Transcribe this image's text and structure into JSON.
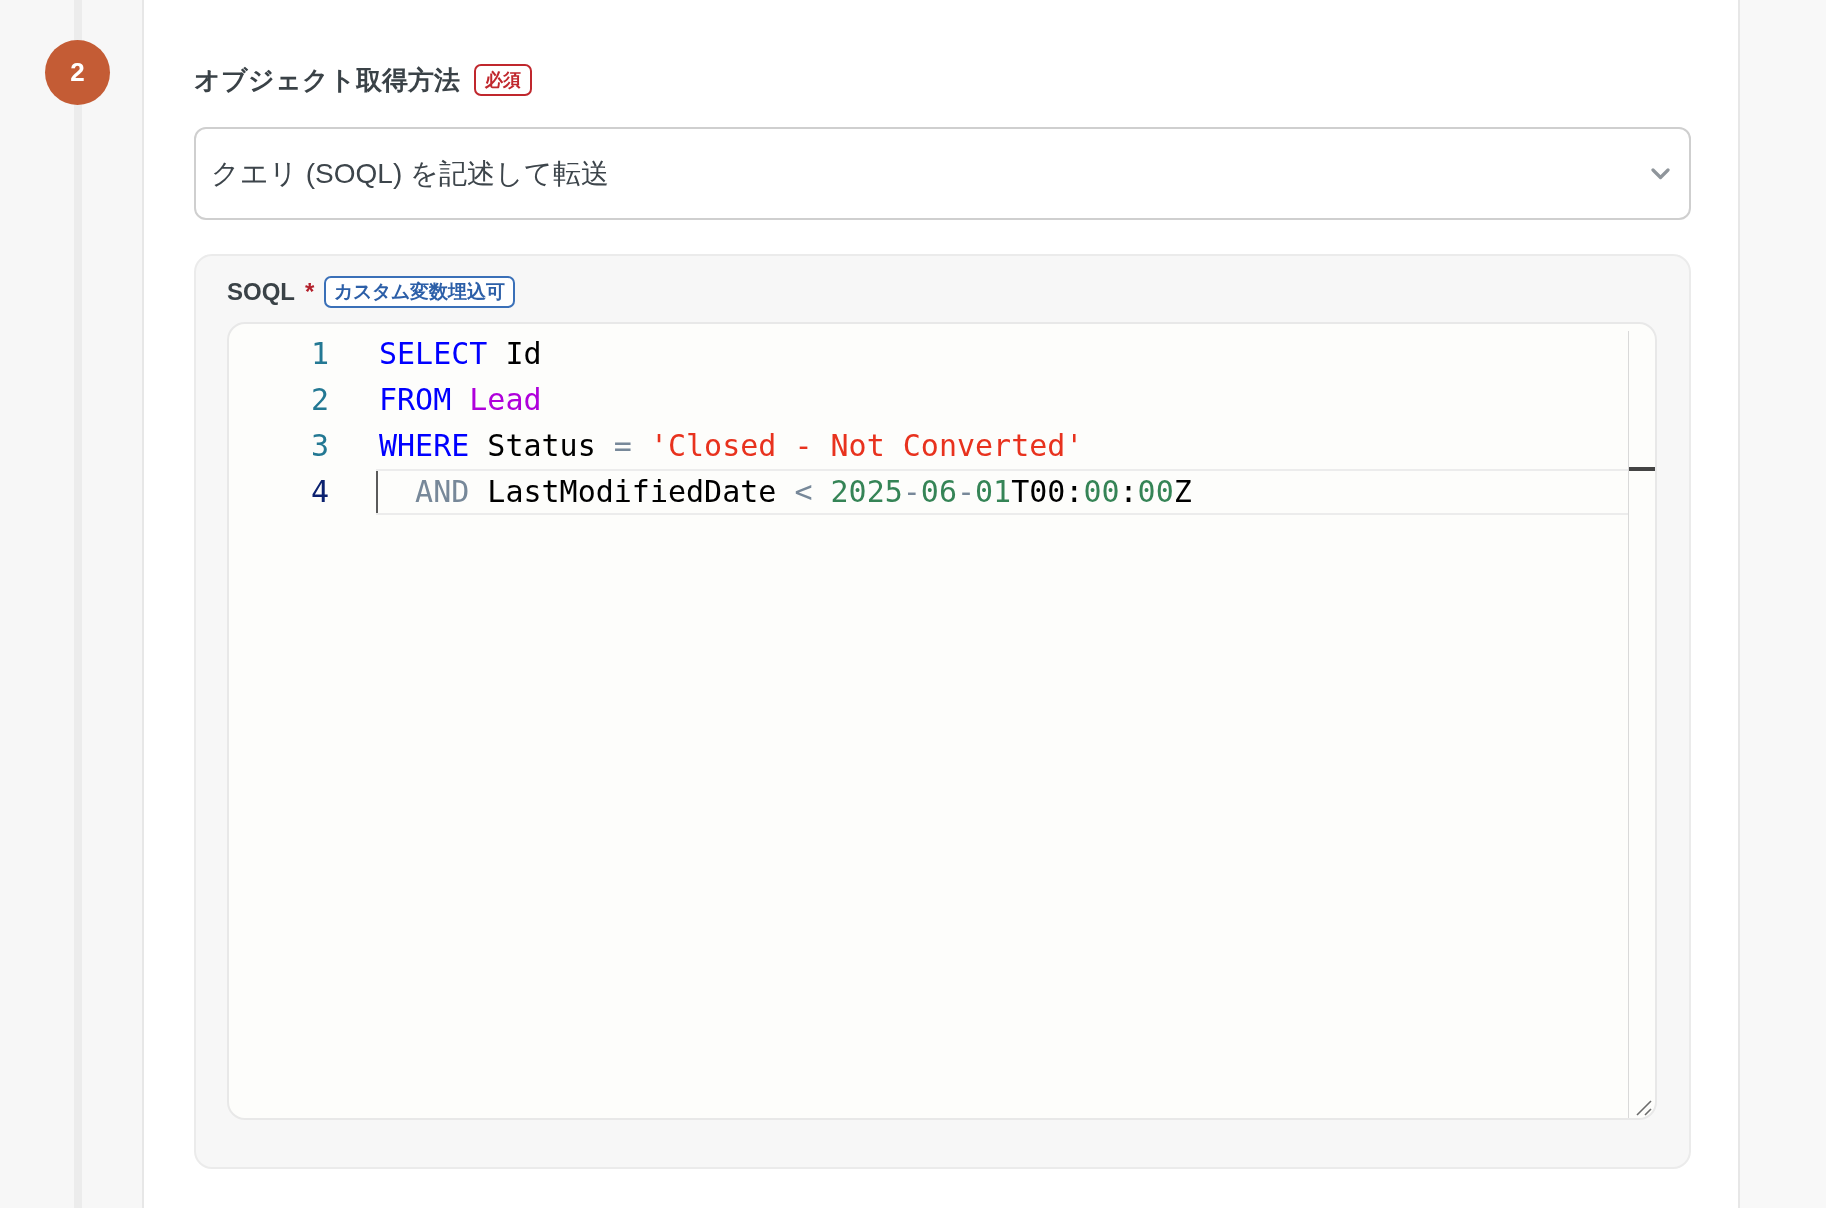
{
  "step": {
    "number": "2"
  },
  "method_field": {
    "label": "オブジェクト取得方法",
    "required_badge": "必須",
    "select": {
      "value": "クエリ (SOQL) を記述して転送"
    }
  },
  "soql_field": {
    "label": "SOQL",
    "required_mark": "*",
    "badge": "カスタム変数埋込可",
    "editor": {
      "lines": [
        {
          "number": "1",
          "active": false,
          "tokens": [
            {
              "text": "SELECT",
              "kind": "keyword"
            },
            {
              "text": " Id",
              "kind": "plain"
            }
          ]
        },
        {
          "number": "2",
          "active": false,
          "tokens": [
            {
              "text": "FROM",
              "kind": "keyword"
            },
            {
              "text": " Lead",
              "kind": "object"
            }
          ]
        },
        {
          "number": "3",
          "active": false,
          "tokens": [
            {
              "text": "WHERE",
              "kind": "keyword"
            },
            {
              "text": " Status ",
              "kind": "plain"
            },
            {
              "text": "=",
              "kind": "operator"
            },
            {
              "text": " 'Closed - Not Converted'",
              "kind": "string"
            }
          ]
        },
        {
          "number": "4",
          "active": true,
          "tokens": [
            {
              "text": "  AND",
              "kind": "operator"
            },
            {
              "text": " LastModifiedDate ",
              "kind": "plain"
            },
            {
              "text": "<",
              "kind": "operator"
            },
            {
              "text": " 2025",
              "kind": "number"
            },
            {
              "text": "-",
              "kind": "operator"
            },
            {
              "text": "06",
              "kind": "number"
            },
            {
              "text": "-",
              "kind": "operator"
            },
            {
              "text": "01",
              "kind": "number"
            },
            {
              "text": "T00:",
              "kind": "plain"
            },
            {
              "text": "00",
              "kind": "number"
            },
            {
              "text": ":",
              "kind": "plain"
            },
            {
              "text": "00",
              "kind": "number"
            },
            {
              "text": "Z",
              "kind": "plain"
            }
          ]
        }
      ]
    }
  }
}
